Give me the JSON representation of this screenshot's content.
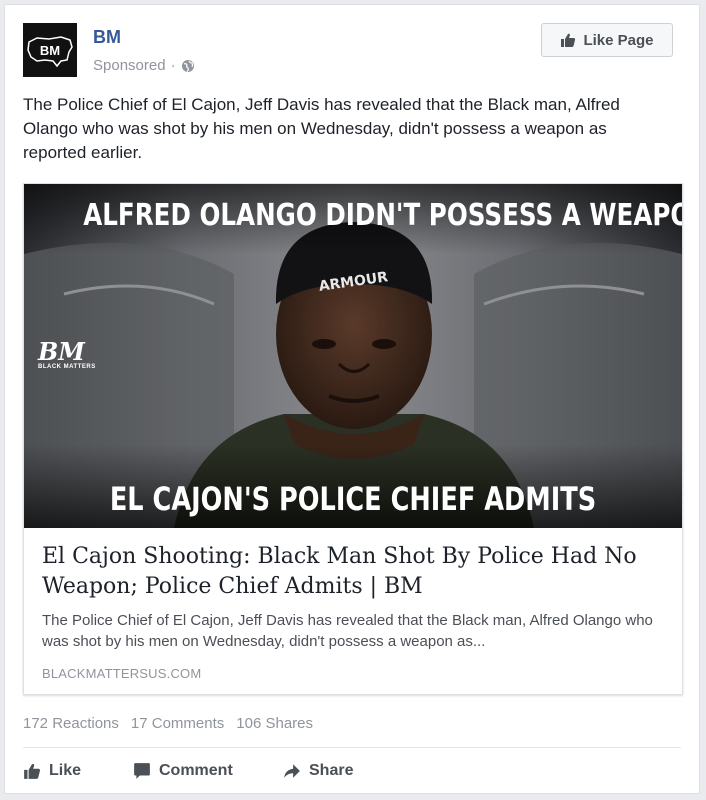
{
  "post": {
    "page_name": "BM",
    "avatar_text": "BM",
    "sponsored_label": "Sponsored",
    "separator": "·",
    "like_page_label": "Like Page",
    "text": "The Police Chief of El Cajon, Jeff Davis has revealed that the Black man, Alfred Olango who was shot by his men on Wednesday, didn't possess a weapon as reported earlier."
  },
  "link": {
    "image_headline_top": "ALFRED OLANGO DIDN'T POSSESS A WEAPON:",
    "image_headline_bottom": "EL CAJON'S POLICE CHIEF ADMITS",
    "watermark_letters": "BM",
    "watermark_sub": "BLACK MATTERS",
    "cap_text": "ARMOUR",
    "title": "El Cajon Shooting: Black Man Shot By Police Had No Weapon; Police Chief Admits | BM",
    "description": "The Police Chief of El Cajon, Jeff Davis has revealed that the Black man, Alfred Olango who was shot by his men on Wednesday, didn't possess a weapon as...",
    "domain": "BLACKMATTERSUS.COM"
  },
  "stats": {
    "reactions": "172 Reactions",
    "comments": "17 Comments",
    "shares": "106 Shares"
  },
  "actions": {
    "like": "Like",
    "comment": "Comment",
    "share": "Share"
  },
  "icons": {
    "globe": "globe-icon",
    "thumbs_up": "thumbs-up-icon",
    "comment": "comment-icon",
    "share": "share-arrow-icon"
  },
  "colors": {
    "page_name": "#365899",
    "meta_gray": "#90949c",
    "text": "#1d2129"
  }
}
